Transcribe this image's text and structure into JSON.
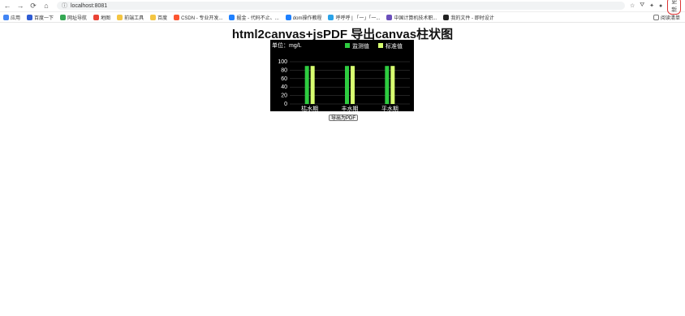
{
  "browser": {
    "url": "localhost:8081",
    "update_label": "更新",
    "bookmarks": [
      "应用",
      "百度一下",
      "网址导航",
      "地图",
      "前端工具",
      "百度",
      "CSDN - 专业开发...",
      "掘金 - 代码不止、...",
      "dom操作教程",
      "呼呼呼 | 「一」「一...",
      "中国计算机技术职...",
      "我的文件 - 即时设计"
    ],
    "reading_list": "阅读清单"
  },
  "page": {
    "title": "html2canvas+jsPDF 导出canvas柱状图",
    "export_label": "导出为PDF"
  },
  "chart_data": {
    "type": "bar",
    "unit_label": "单位：mg/L",
    "categories": [
      "枯水期",
      "丰水期",
      "平水期"
    ],
    "series": [
      {
        "name": "监测值",
        "values": [
          90,
          90,
          90
        ],
        "color": "#2ecc40"
      },
      {
        "name": "标准值",
        "values": [
          90,
          90,
          90
        ],
        "color": "#d7ff70"
      }
    ],
    "ylim": [
      0,
      100
    ],
    "yticks": [
      0,
      20,
      40,
      60,
      80,
      100
    ],
    "grid": true
  }
}
